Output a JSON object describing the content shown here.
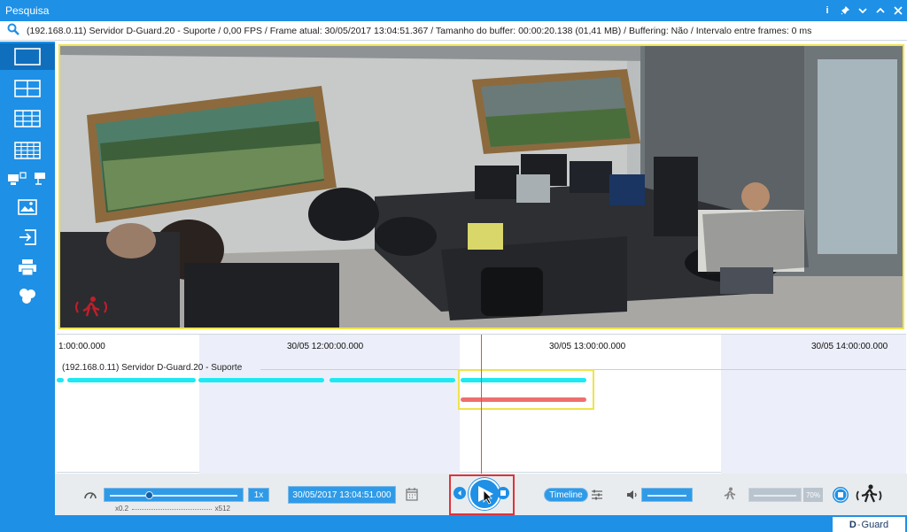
{
  "window": {
    "title": "Pesquisa",
    "buttons": [
      "info-icon",
      "pin-icon",
      "minimize-icon",
      "maximize-icon",
      "close-icon"
    ]
  },
  "infobar": {
    "text": "(192.168.0.11) Servidor D-Guard.20 - Suporte / 0,00 FPS / Frame atual: 30/05/2017 13:04:51.367 / Tamanho do buffer: 00:00:20.138 (01,41 MB) / Buffering: Não / Intervalo entre frames: 0 ms"
  },
  "sidebar": {
    "items": [
      {
        "name": "layout-1x1-icon",
        "active": true
      },
      {
        "name": "layout-2x2-icon",
        "active": false
      },
      {
        "name": "layout-3x3-icon",
        "active": false
      },
      {
        "name": "layout-4x4-icon",
        "active": false
      },
      {
        "name": "network-cameras-icon",
        "active": false
      },
      {
        "name": "snapshot-image-icon",
        "active": false
      },
      {
        "name": "export-icon",
        "active": false
      },
      {
        "name": "print-icon",
        "active": false
      },
      {
        "name": "clips-icon",
        "active": false
      }
    ]
  },
  "timeline": {
    "ticks": [
      "1:00:00.000",
      "30/05 12:00:00.000",
      "30/05 13:00:00.000",
      "30/05 14:00:00.000"
    ],
    "channel": "(192.168.0.11) Servidor D-Guard.20 - Suporte",
    "colors": {
      "recording": "#1de9f2",
      "motion": "#ee6f6f",
      "band": "#eceef9",
      "playhead": "#d9534f",
      "selection": "#eee449"
    }
  },
  "controls": {
    "speed_multiplier": "1x",
    "speed_min": "x0.2",
    "speed_max": "x512",
    "current_datetime": "30/05/2017 13:04:51.000",
    "timeline_label": "Timeline",
    "motion_percent": "70%"
  },
  "statusbar": {
    "brand_d": "D",
    "brand_dash": "-",
    "brand_rest": "Guard"
  },
  "theme": {
    "accent": "#1e90e6",
    "accent_dark": "#0f6fbd",
    "video_border": "#f0e44a",
    "play_border": "#e0333a"
  }
}
